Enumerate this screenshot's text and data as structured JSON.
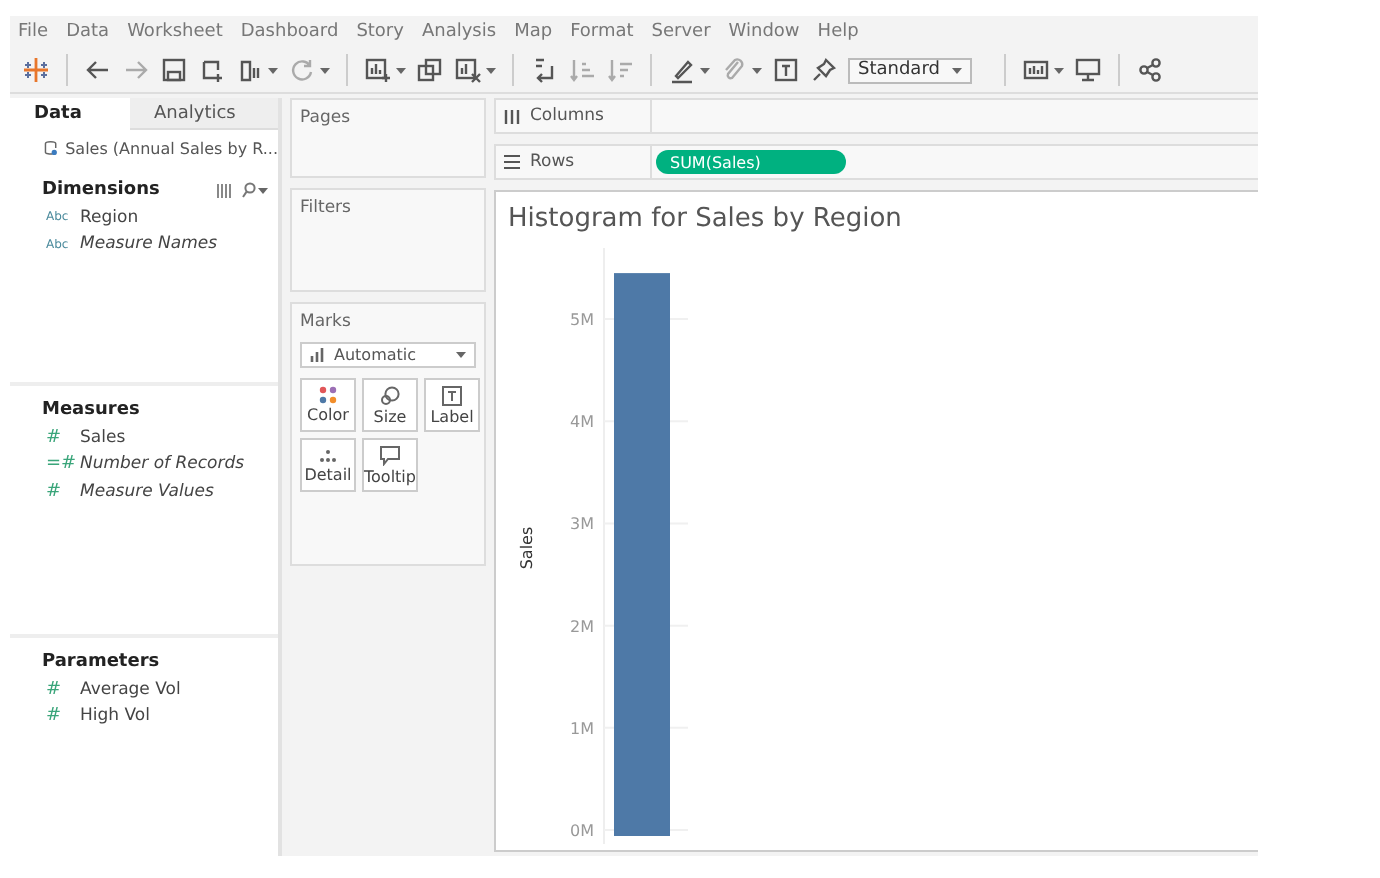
{
  "menu": [
    "File",
    "Data",
    "Worksheet",
    "Dashboard",
    "Story",
    "Analysis",
    "Map",
    "Format",
    "Server",
    "Window",
    "Help"
  ],
  "toolbar": {
    "fit_mode": "Standard"
  },
  "data_pane": {
    "tabs": [
      {
        "label": "Data",
        "selected": true
      },
      {
        "label": "Analytics",
        "selected": false
      }
    ],
    "source": "Sales (Annual Sales by R...",
    "sections": [
      {
        "title": "Dimensions",
        "tools": true,
        "items": [
          {
            "glyph": "Abc",
            "label": "Region",
            "italic": false
          },
          {
            "glyph": "Abc",
            "label": "Measure Names",
            "italic": true
          }
        ]
      },
      {
        "title": "Measures",
        "tools": false,
        "items": [
          {
            "glyph": "#",
            "label": "Sales",
            "italic": false
          },
          {
            "glyph": "=#",
            "label": "Number of Records",
            "italic": true
          },
          {
            "glyph": "#",
            "label": "Measure Values",
            "italic": true
          }
        ]
      },
      {
        "title": "Parameters",
        "tools": false,
        "items": [
          {
            "glyph": "#",
            "label": "Average Vol",
            "italic": false
          },
          {
            "glyph": "#",
            "label": "High Vol",
            "italic": false
          }
        ]
      }
    ]
  },
  "cards": {
    "pages": "Pages",
    "filters": "Filters",
    "marks": {
      "title": "Marks",
      "mark_type": "Automatic",
      "buttons": [
        {
          "kind": "color",
          "label": "Color"
        },
        {
          "kind": "size",
          "label": "Size"
        },
        {
          "kind": "label",
          "label": "Label"
        },
        {
          "kind": "detail",
          "label": "Detail"
        },
        {
          "kind": "tooltip",
          "label": "Tooltip"
        }
      ]
    }
  },
  "shelves": [
    {
      "kind": "columns",
      "label": "Columns"
    },
    {
      "kind": "rows",
      "label": "Rows",
      "pills": [
        "SUM(Sales)"
      ]
    }
  ],
  "view": {
    "chart_data": {
      "type": "bar",
      "title": "Histogram for Sales by Region",
      "ylabel": "Sales",
      "ylim": [
        0,
        5500000
      ],
      "yticks": [
        {
          "value": 0,
          "label": "0M"
        },
        {
          "value": 1000000,
          "label": "1M"
        },
        {
          "value": 2000000,
          "label": "2M"
        },
        {
          "value": 3000000,
          "label": "3M"
        },
        {
          "value": 4000000,
          "label": "4M"
        },
        {
          "value": 5000000,
          "label": "5M"
        }
      ],
      "grid": true,
      "series": [
        {
          "color": "#4e79a7",
          "values": [
            5450000
          ]
        }
      ]
    }
  }
}
